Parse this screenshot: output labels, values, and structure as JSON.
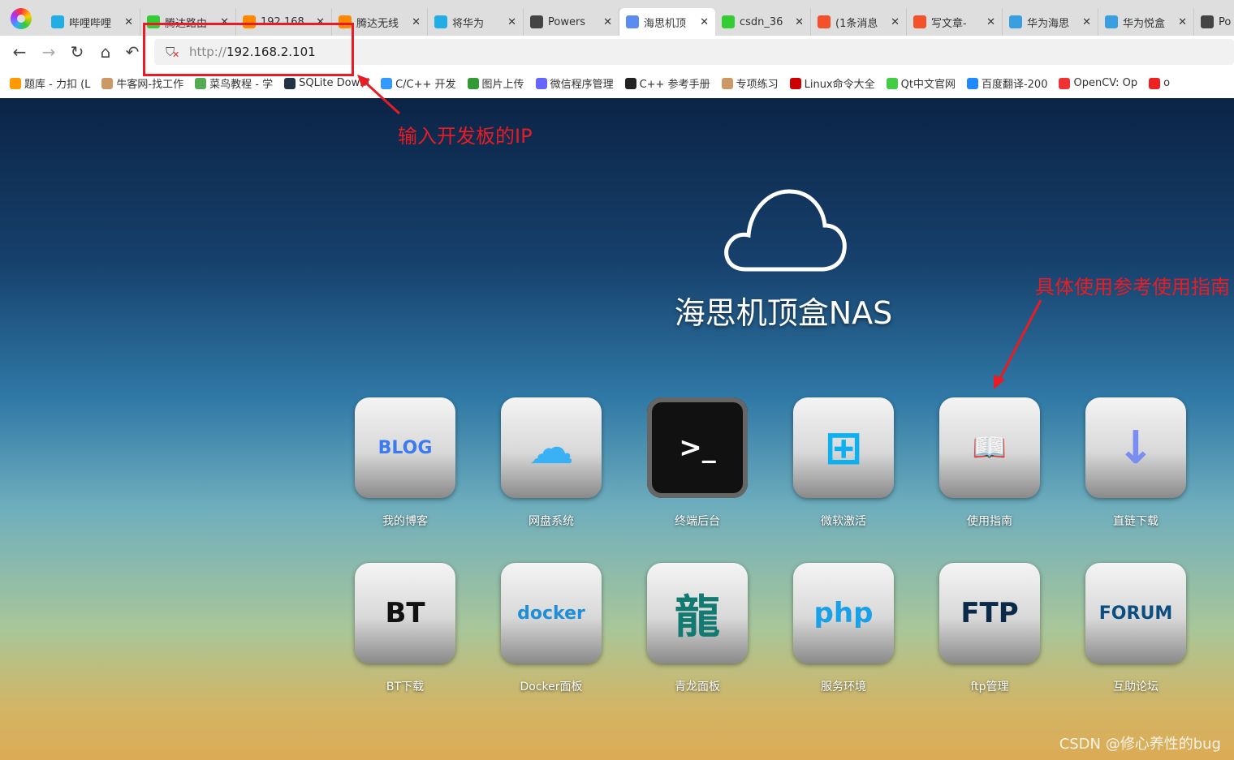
{
  "tabs": [
    {
      "label": "哔哩哔哩",
      "color": "#23ade5"
    },
    {
      "label": "腾达路由",
      "color": "#3c3"
    },
    {
      "label": "192.168",
      "color": "#f80"
    },
    {
      "label": "腾达无线",
      "color": "#f80"
    },
    {
      "label": "将华为",
      "color": "#23ade5"
    },
    {
      "label": "Powers",
      "color": "#444"
    },
    {
      "label": "海思机顶",
      "color": "#5b8cf0",
      "active": true
    },
    {
      "label": "csdn_36",
      "color": "#3c3"
    },
    {
      "label": "(1条消息",
      "color": "#f4502a"
    },
    {
      "label": "写文章-",
      "color": "#f4502a"
    },
    {
      "label": "华为海思",
      "color": "#3a9fe0"
    },
    {
      "label": "华为悦盒",
      "color": "#3a9fe0"
    },
    {
      "label": "Po",
      "color": "#444"
    }
  ],
  "nav": {
    "url_scheme": "http://",
    "url_host": "192.168.2.101"
  },
  "bookmarks": [
    {
      "label": "题库 - 力扣 (L",
      "color": "#f90"
    },
    {
      "label": "牛客网-找工作",
      "color": "#c96"
    },
    {
      "label": "菜鸟教程 - 学",
      "color": "#5a5"
    },
    {
      "label": "SQLite Downl",
      "color": "#234"
    },
    {
      "label": "C/C++ 开发",
      "color": "#39f"
    },
    {
      "label": "图片上传",
      "color": "#393"
    },
    {
      "label": "微信程序管理",
      "color": "#66f"
    },
    {
      "label": "C++ 参考手册",
      "color": "#222"
    },
    {
      "label": "专项练习",
      "color": "#c96"
    },
    {
      "label": "Linux命令大全",
      "color": "#c00"
    },
    {
      "label": "Qt中文官网",
      "color": "#4c4"
    },
    {
      "label": "百度翻译-200",
      "color": "#28f"
    },
    {
      "label": "OpenCV: Op",
      "color": "#e33"
    },
    {
      "label": "o",
      "color": "#e22"
    }
  ],
  "page": {
    "title": "海思机顶盒NAS"
  },
  "apps": [
    {
      "label": "我的博客",
      "glyph": "BLOG",
      "fg": "#3b7bf0"
    },
    {
      "label": "网盘系统",
      "glyph": "☁",
      "fg": "#3ab0f5"
    },
    {
      "label": "终端后台",
      "glyph": ">_",
      "fg": "#fff"
    },
    {
      "label": "微软激活",
      "glyph": "⊞",
      "fg": "#0fb0f0"
    },
    {
      "label": "使用指南",
      "glyph": "📖",
      "fg": "#444"
    },
    {
      "label": "直链下载",
      "glyph": "↓",
      "fg": "#7a8df0"
    },
    {
      "label": "BT下载",
      "glyph": "BT",
      "fg": "#111"
    },
    {
      "label": "Docker面板",
      "glyph": "docker",
      "fg": "#1d8fd8"
    },
    {
      "label": "青龙面板",
      "glyph": "龍",
      "fg": "#127a70"
    },
    {
      "label": "服务环境",
      "glyph": "php",
      "fg": "#1aa0e6"
    },
    {
      "label": "ftp管理",
      "glyph": "FTP",
      "fg": "#0b2a4a"
    },
    {
      "label": "互助论坛",
      "glyph": "FORUM",
      "fg": "#0d4e80"
    }
  ],
  "annotations": {
    "ip_note": "输入开发板的IP",
    "guide_note": "具体使用参考使用指南",
    "color": "#e81c24"
  },
  "watermark": "CSDN @修心养性的bug"
}
